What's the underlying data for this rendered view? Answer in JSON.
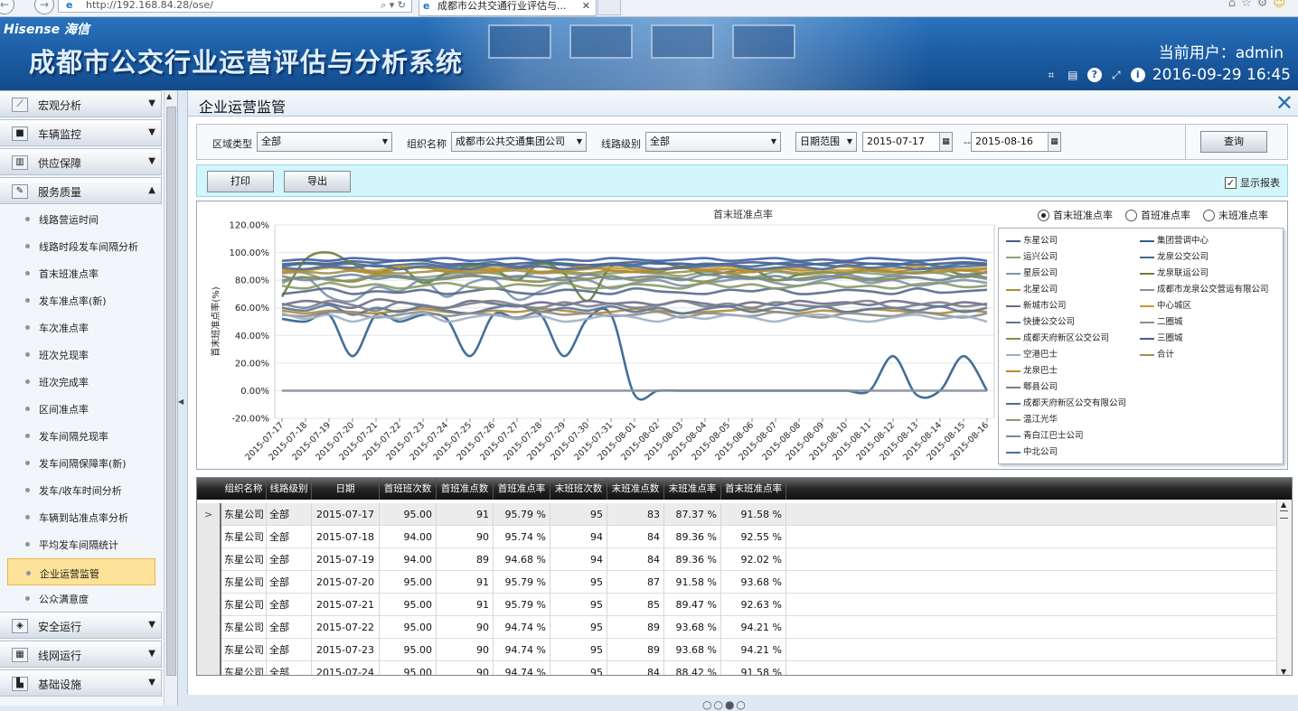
{
  "browser": {
    "address": "http://192.168.84.28/ose/",
    "tab_title": "成都市公共交通行业评估与...",
    "close_glyph": "✕"
  },
  "banner": {
    "brand": "Hisense 海信",
    "system_title": "成都市公交行业运营评估与分析系统",
    "user_label": "当前用户：admin",
    "datetime": "2016-09-29 16:45"
  },
  "sidebar": {
    "groups_top": [
      {
        "label": "宏观分析",
        "icon": "trend-chart-icon"
      },
      {
        "label": "车辆监控",
        "icon": "vehicle-monitor-icon"
      },
      {
        "label": "供应保障",
        "icon": "supply-icon"
      },
      {
        "label": "服务质量",
        "icon": "service-quality-icon",
        "expanded": true
      }
    ],
    "sub_items": [
      "线路营运时间",
      "线路时段发车间隔分析",
      "首末班准点率",
      "发车准点率(新)",
      "车次准点率",
      "班次兑现率",
      "班次完成率",
      "区间准点率",
      "发车间隔兑现率",
      "发车间隔保障率(新)",
      "发车/收车时间分析",
      "车辆到站准点率分析",
      "平均发车间隔统计",
      "企业运营监管",
      "公众满意度"
    ],
    "active_sub": "企业运营监管",
    "groups_bottom": [
      {
        "label": "安全运行",
        "icon": "safety-icon"
      },
      {
        "label": "线网运行",
        "icon": "network-icon"
      },
      {
        "label": "基础设施",
        "icon": "infrastructure-icon"
      }
    ]
  },
  "page": {
    "title": "企业运营监管"
  },
  "filters": {
    "region_label": "区域类型",
    "region_value": "全部",
    "org_label": "组织名称",
    "org_value": "成都市公共交通集团公司",
    "level_label": "线路级别",
    "level_value": "全部",
    "range_value": "日期范围",
    "date_from": "2015-07-17",
    "date_sep": "--",
    "date_to": "2015-08-16",
    "query_button": "查询"
  },
  "actions": {
    "print": "打印",
    "export": "导出",
    "show_report": "显示报表",
    "show_report_checked": true
  },
  "chart_data": {
    "type": "line",
    "title": "首末班准点率",
    "ylabel": "首末班准点率(%)",
    "ylim": [
      -20,
      120
    ],
    "y_ticks": [
      "120.00%",
      "100.00%",
      "80.00%",
      "60.00%",
      "40.00%",
      "20.00%",
      "0.00%",
      "-20.00%"
    ],
    "x": [
      "2015-07-17",
      "2015-07-18",
      "2015-07-19",
      "2015-07-20",
      "2015-07-21",
      "2015-07-22",
      "2015-07-23",
      "2015-07-24",
      "2015-07-25",
      "2015-07-26",
      "2015-07-27",
      "2015-07-28",
      "2015-07-29",
      "2015-07-30",
      "2015-07-31",
      "2015-08-01",
      "2015-08-02",
      "2015-08-03",
      "2015-08-04",
      "2015-08-05",
      "2015-08-06",
      "2015-08-07",
      "2015-08-08",
      "2015-08-09",
      "2015-08-10",
      "2015-08-11",
      "2015-08-12",
      "2015-08-13",
      "2015-08-14",
      "2015-08-15",
      "2015-08-16"
    ],
    "grid": true,
    "legend_position": "right",
    "radio_options": [
      {
        "label": "首末班准点率",
        "selected": true
      },
      {
        "label": "首班准点率",
        "selected": false
      },
      {
        "label": "末班准点率",
        "selected": false
      }
    ],
    "series": [
      {
        "name": "东星公司",
        "color": "#4a5a8a",
        "values": [
          91.58,
          92.55,
          92.02,
          93.68,
          92.63,
          94.21,
          94.21,
          91.58,
          92,
          91,
          92,
          93,
          92,
          91,
          92,
          93,
          92,
          92,
          91,
          92,
          93,
          92,
          91,
          92,
          93,
          92,
          92,
          91,
          92,
          93,
          92
        ]
      },
      {
        "name": "集团营调中心",
        "color": "#2f5f8f",
        "values": [
          52,
          50,
          55,
          25,
          55,
          50,
          55,
          52,
          25,
          55,
          52,
          55,
          25,
          52,
          55,
          -3,
          0,
          0,
          0,
          0,
          0,
          0,
          0,
          0,
          0,
          0,
          25,
          -3,
          0,
          25,
          0
        ]
      },
      {
        "name": "运兴公司",
        "color": "#8aa07a",
        "values": [
          88,
          85,
          80,
          80,
          84,
          83,
          82,
          84,
          86,
          85,
          82,
          86,
          85,
          84,
          85,
          86,
          85,
          83,
          86,
          85,
          82,
          86,
          84,
          85,
          86,
          85,
          84,
          86,
          85,
          82,
          86
        ]
      },
      {
        "name": "龙泉公交公司",
        "color": "#3e6c95",
        "values": [
          90,
          92,
          91,
          92,
          90,
          91,
          92,
          90,
          91,
          93,
          90,
          92,
          91,
          90,
          92,
          91,
          93,
          90,
          92,
          91,
          90,
          92,
          93,
          91,
          90,
          92,
          91,
          93,
          90,
          92,
          91
        ]
      },
      {
        "name": "星辰公司",
        "color": "#7d93ad",
        "values": [
          78,
          82,
          68,
          65,
          75,
          72,
          80,
          68,
          78,
          80,
          66,
          72,
          78,
          80,
          74,
          78,
          80,
          76,
          78,
          80,
          82,
          78,
          76,
          80,
          82,
          78,
          80,
          76,
          78,
          80,
          78
        ]
      },
      {
        "name": "龙泉联运公司",
        "color": "#6c7f3c",
        "values": [
          68,
          95,
          100,
          92,
          85,
          90,
          78,
          85,
          90,
          88,
          80,
          92,
          85,
          65,
          90,
          88,
          86,
          90,
          84,
          86,
          88,
          80,
          84,
          86,
          85,
          88,
          86,
          85,
          88,
          84,
          86
        ]
      },
      {
        "name": "北星公司",
        "color": "#b08a3a",
        "values": [
          58,
          56,
          58,
          57,
          56,
          58,
          59,
          57,
          56,
          58,
          57,
          59,
          58,
          56,
          57,
          59,
          58,
          56,
          57,
          58,
          59,
          57,
          56,
          58,
          57,
          59,
          58,
          57,
          56,
          58,
          57
        ]
      },
      {
        "name": "成都市龙泉公交营运有限公司",
        "color": "#8a8fa0",
        "values": [
          0,
          0,
          0,
          0,
          0,
          0,
          0,
          0,
          0,
          0,
          0,
          0,
          0,
          0,
          0,
          0,
          0,
          0,
          0,
          0,
          0,
          0,
          0,
          0,
          0,
          0,
          0,
          0,
          0,
          0,
          0
        ]
      },
      {
        "name": "新城市公司",
        "color": "#6d6a8a",
        "values": [
          62,
          65,
          63,
          60,
          66,
          64,
          62,
          60,
          65,
          63,
          61,
          64,
          62,
          65,
          63,
          64,
          62,
          65,
          63,
          61,
          64,
          62,
          65,
          63,
          64,
          62,
          65,
          63,
          61,
          64,
          62
        ]
      },
      {
        "name": "中心城区",
        "color": "#c89a35",
        "values": [
          88,
          87,
          89,
          88,
          87,
          90,
          89,
          88,
          87,
          89,
          88,
          90,
          87,
          88,
          89,
          88,
          87,
          89,
          88,
          90,
          87,
          88,
          89,
          88,
          87,
          89,
          88,
          90,
          87,
          88,
          89
        ]
      },
      {
        "name": "快捷公交公司",
        "color": "#5a7596",
        "values": [
          60,
          58,
          62,
          55,
          60,
          57,
          61,
          58,
          56,
          60,
          62,
          57,
          60,
          58,
          61,
          57,
          60,
          56,
          59,
          61,
          57,
          60,
          58,
          61,
          57,
          59,
          60,
          58,
          61,
          57,
          60
        ]
      },
      {
        "name": "二圈城",
        "color": "#8d8d8d",
        "values": [
          55,
          54,
          57,
          56,
          53,
          55,
          57,
          54,
          56,
          55,
          53,
          57,
          55,
          56,
          54,
          55,
          57,
          53,
          56,
          55,
          54,
          57,
          55,
          53,
          56,
          55,
          54,
          57,
          55,
          53,
          56
        ]
      },
      {
        "name": "成都天府新区公交公司",
        "color": "#8c8a4a",
        "values": [
          80,
          82,
          81,
          79,
          83,
          82,
          80,
          81,
          83,
          82,
          80,
          79,
          82,
          81,
          83,
          80,
          82,
          81,
          79,
          83,
          82,
          80,
          81,
          83,
          82,
          80,
          81,
          82,
          80,
          83,
          81
        ]
      },
      {
        "name": "三圈城",
        "color": "#3f5fa0",
        "values": [
          94,
          95,
          94,
          96,
          95,
          94,
          95,
          96,
          94,
          95,
          96,
          94,
          95,
          94,
          96,
          95,
          94,
          95,
          96,
          94,
          95,
          96,
          94,
          95,
          94,
          96,
          95,
          94,
          95,
          96,
          94
        ]
      },
      {
        "name": "空港巴士",
        "color": "#9eb0c4",
        "values": [
          56,
          52,
          55,
          50,
          54,
          52,
          56,
          50,
          53,
          55,
          52,
          54,
          50,
          52,
          55,
          53,
          50,
          54,
          52,
          55,
          53,
          50,
          54,
          55,
          52,
          50,
          53,
          55,
          52,
          54,
          50
        ]
      },
      {
        "name": "合计",
        "color": "#a09050",
        "values": [
          85,
          86,
          85,
          87,
          86,
          85,
          86,
          87,
          85,
          86,
          87,
          85,
          86,
          85,
          87,
          86,
          85,
          86,
          87,
          85,
          86,
          87,
          85,
          86,
          85,
          87,
          86,
          85,
          86,
          87,
          85
        ]
      },
      {
        "name": "龙泉巴士",
        "color": "#b88a2a",
        "values": [
          86,
          88,
          90,
          87,
          85,
          88,
          90,
          86,
          88,
          87,
          89,
          86,
          88,
          90,
          87,
          86,
          88,
          89,
          87,
          88,
          86,
          89,
          87,
          88,
          90,
          87,
          86,
          88,
          89,
          87,
          88
        ]
      },
      {
        "name": "郫县公司",
        "color": "#7a7f89",
        "values": [
          63,
          60,
          65,
          62,
          58,
          64,
          61,
          60,
          63,
          65,
          62,
          60,
          64,
          61,
          63,
          60,
          62,
          65,
          61,
          63,
          60,
          64,
          62,
          61,
          63,
          65,
          60,
          62,
          64,
          61,
          63
        ]
      },
      {
        "name": "成都天府新区公交有限公司",
        "color": "#55698a",
        "values": [
          70,
          72,
          74,
          70,
          72,
          71,
          73,
          70,
          72,
          74,
          71,
          70,
          73,
          72,
          70,
          74,
          72,
          71,
          70,
          73,
          72,
          74,
          70,
          71,
          73,
          72,
          70,
          74,
          71,
          72,
          73
        ]
      },
      {
        "name": "温江光华",
        "color": "#8a9a6a",
        "values": [
          76,
          74,
          78,
          75,
          77,
          74,
          76,
          78,
          75,
          74,
          77,
          76,
          78,
          74,
          75,
          77,
          76,
          74,
          78,
          75,
          77,
          74,
          76,
          78,
          75,
          76,
          74,
          77,
          78,
          75,
          76
        ]
      },
      {
        "name": "青白江巴士公司",
        "color": "#6f8aa6",
        "values": [
          83,
          80,
          82,
          84,
          81,
          83,
          80,
          82,
          84,
          81,
          83,
          82,
          80,
          84,
          81,
          82,
          83,
          80,
          84,
          82,
          81,
          83,
          80,
          82,
          84,
          81,
          83,
          82,
          80,
          84,
          82
        ]
      },
      {
        "name": "中北公司",
        "color": "#4f6f9f",
        "values": [
          89,
          88,
          90,
          89,
          91,
          88,
          90,
          89,
          88,
          91,
          89,
          90,
          88,
          89,
          91,
          90,
          88,
          89,
          90,
          91,
          88,
          89,
          90,
          88,
          91,
          89,
          90,
          88,
          89,
          90,
          91
        ]
      }
    ]
  },
  "table": {
    "columns": [
      "组织名称",
      "线路级别",
      "日期",
      "首班班次数",
      "首班准点数",
      "首班准点率",
      "末班班次数",
      "末班准点数",
      "末班准点率",
      "首末班准点率"
    ],
    "rows": [
      [
        "东星公司",
        "全部",
        "2015-07-17",
        "95.00",
        "91",
        "95.79 %",
        "95",
        "83",
        "87.37 %",
        "91.58 %"
      ],
      [
        "东星公司",
        "全部",
        "2015-07-18",
        "94.00",
        "90",
        "95.74 %",
        "94",
        "84",
        "89.36 %",
        "92.55 %"
      ],
      [
        "东星公司",
        "全部",
        "2015-07-19",
        "94.00",
        "89",
        "94.68 %",
        "94",
        "84",
        "89.36 %",
        "92.02 %"
      ],
      [
        "东星公司",
        "全部",
        "2015-07-20",
        "95.00",
        "91",
        "95.79 %",
        "95",
        "87",
        "91.58 %",
        "93.68 %"
      ],
      [
        "东星公司",
        "全部",
        "2015-07-21",
        "95.00",
        "91",
        "95.79 %",
        "95",
        "85",
        "89.47 %",
        "92.63 %"
      ],
      [
        "东星公司",
        "全部",
        "2015-07-22",
        "95.00",
        "90",
        "94.74 %",
        "95",
        "89",
        "93.68 %",
        "94.21 %"
      ],
      [
        "东星公司",
        "全部",
        "2015-07-23",
        "95.00",
        "90",
        "94.74 %",
        "95",
        "89",
        "93.68 %",
        "94.21 %"
      ],
      [
        "东星公司",
        "全部",
        "2015-07-24",
        "95.00",
        "90",
        "94.74 %",
        "95",
        "84",
        "88.42 %",
        "91.58 %"
      ]
    ],
    "row_marker": ">"
  }
}
